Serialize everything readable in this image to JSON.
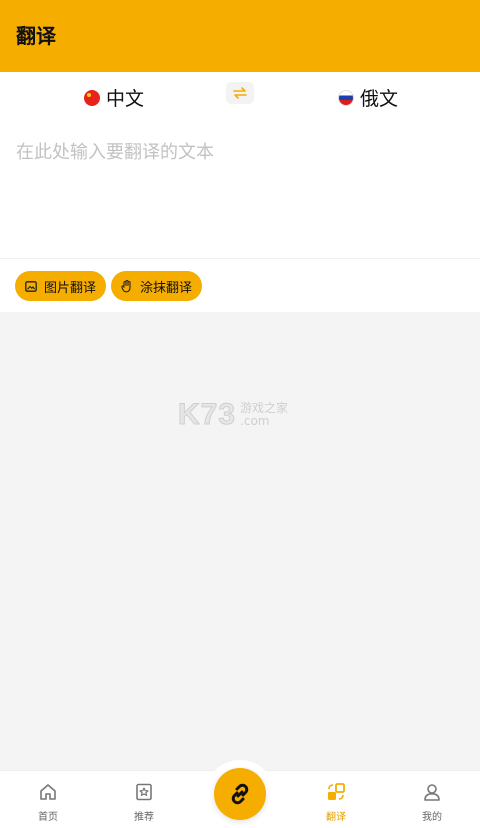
{
  "header": {
    "title": "翻译"
  },
  "languages": {
    "source": {
      "label": "中文",
      "flag": "cn-flag"
    },
    "target": {
      "label": "俄文",
      "flag": "ru-flag"
    },
    "swap_icon": "swap-arrows-icon"
  },
  "input": {
    "placeholder": "在此处输入要翻译的文本",
    "value": ""
  },
  "tools": {
    "image_translate": "图片翻译",
    "smear_translate": "涂抹翻译"
  },
  "watermark": {
    "mark": "K73",
    "line1": "游戏之家",
    "line2": ".com"
  },
  "tabbar": {
    "items": [
      {
        "label": "首页",
        "icon": "home-icon",
        "active": false
      },
      {
        "label": "推荐",
        "icon": "star-bookmark-icon",
        "active": false
      },
      {
        "label": "翻译",
        "icon": "translate-icon",
        "active": true
      },
      {
        "label": "我的",
        "icon": "user-icon",
        "active": false
      }
    ],
    "center_icon": "link-icon"
  },
  "colors": {
    "accent": "#f5ad00",
    "background": "#f4f4f4",
    "placeholder": "#c2c2c2"
  }
}
